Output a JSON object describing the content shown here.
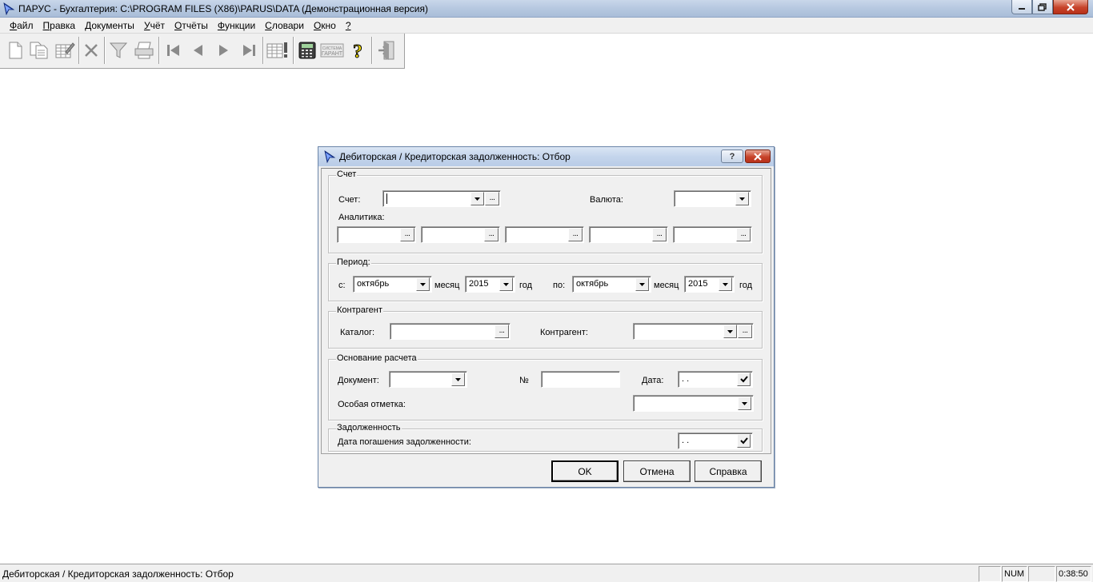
{
  "window": {
    "title": "ПАРУС - Бухгалтерия: C:\\PROGRAM FILES (X86)\\PARUS\\DATA (Демонстрационная версия)",
    "icons": [
      "app-arrow-icon",
      "minimize-icon",
      "maximize-icon",
      "close-icon"
    ]
  },
  "menu": {
    "items": [
      {
        "u": "Ф",
        "rest": "айл"
      },
      {
        "u": "П",
        "rest": "равка"
      },
      {
        "u": "Д",
        "rest": "окументы"
      },
      {
        "u": "У",
        "rest": "чёт"
      },
      {
        "u": "О",
        "rest": "тчёты"
      },
      {
        "u": "Ф",
        "rest": "ункции"
      },
      {
        "u": "С",
        "rest": "ловари"
      },
      {
        "u": "О",
        "rest": "кно"
      },
      {
        "u": "?",
        "rest": ""
      }
    ]
  },
  "toolbar": {
    "icons": [
      "new-doc-icon",
      "copy-doc-icon",
      "edit-doc-icon",
      "delete-icon",
      "filter-icon",
      "print-icon",
      "first-record-icon",
      "prev-record-icon",
      "next-record-icon",
      "last-record-icon",
      "table-alert-icon",
      "calculator-icon",
      "garant-icon",
      "help-icon",
      "exit-icon"
    ],
    "garant_text": "СИСТЕМА\nГАРАНТ"
  },
  "dialog": {
    "title": "Дебиторская / Кредиторская задолженность: Отбор",
    "help_label": "?",
    "account_group": {
      "legend": "Счет",
      "account_label": "Счет:",
      "account_value": "",
      "currency_label": "Валюта:",
      "currency_value": "",
      "analytics_label": "Аналитика:",
      "analytics_values": [
        "",
        "",
        "",
        "",
        ""
      ],
      "dots": "..."
    },
    "period_group": {
      "legend": "Период:",
      "from_label": "с:",
      "from_month": "октябрь",
      "month_label": "месяц",
      "from_year": "2015",
      "year_label": "год",
      "to_label": "по:",
      "to_month": "октябрь",
      "to_year": "2015"
    },
    "counterparty_group": {
      "legend": "Контрагент",
      "catalog_label": "Каталог:",
      "catalog_value": "",
      "counterparty_label": "Контрагент:",
      "counterparty_value": ""
    },
    "basis_group": {
      "legend": "Основание расчета",
      "document_label": "Документ:",
      "document_value": "",
      "number_label": "№",
      "number_value": "",
      "date_label": "Дата:",
      "date_value": " .  .",
      "special_mark_label": "Особая отметка:",
      "special_mark_value": ""
    },
    "debt_group": {
      "legend": "Задолженность",
      "repay_date_label": "Дата погашения задолженности:",
      "repay_date_value": " .  ."
    },
    "buttons": {
      "ok": "OK",
      "cancel": "Отмена",
      "help": "Справка"
    }
  },
  "statusbar": {
    "text": "Дебиторская / Кредиторская задолженность: Отбор",
    "num": "NUM",
    "time": "0:38:50"
  }
}
